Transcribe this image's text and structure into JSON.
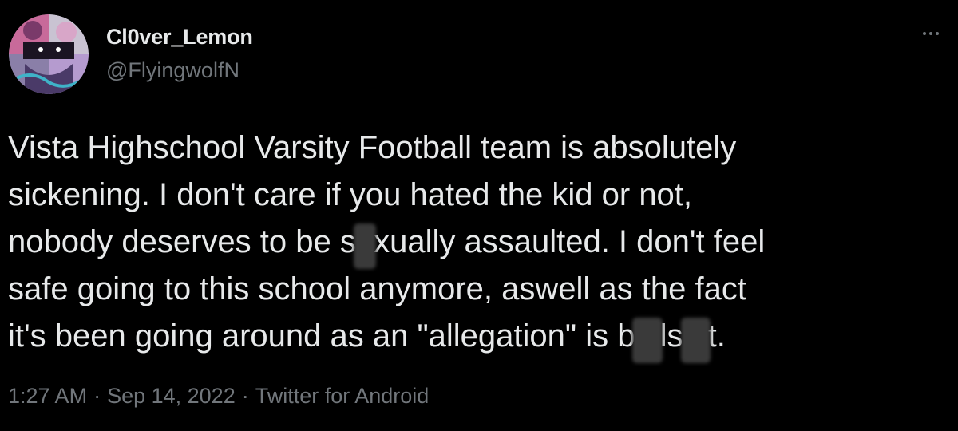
{
  "user": {
    "display_name": "Cl0ver_Lemon",
    "handle": "@FlyingwolfN"
  },
  "tweet": {
    "line1": "Vista Highschool Varsity Football team is absolutely",
    "line2": "sickening. I don't care if you hated the kid or not,",
    "line3_a": "nobody deserves to be s",
    "line3_b": "xually assaulted. I don't feel",
    "line4": "safe going to this school anymore, aswell as the fact",
    "line5_a": "it's been going around as an \"allegation\" is b",
    "line5_b": "ls",
    "line5_c": "t."
  },
  "meta": {
    "time": "1:27 AM",
    "separator": "·",
    "date": "Sep 14, 2022",
    "source": "Twitter for Android"
  },
  "icons": {
    "more": "more-horizontal-icon",
    "avatar": "avatar-image"
  },
  "colors": {
    "background": "#000000",
    "text_primary": "#e7e9ea",
    "text_secondary": "#71767b",
    "censor_blur": "#3a3a3a"
  }
}
